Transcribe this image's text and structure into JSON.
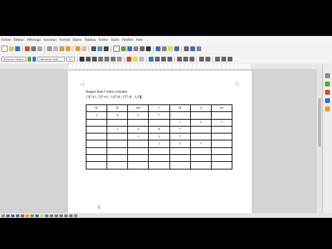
{
  "menu": {
    "items": [
      "Fichier",
      "Édition",
      "Affichage",
      "Insertion",
      "Format",
      "Styles",
      "Tableau",
      "Forme",
      "Outils",
      "Fenêtre",
      "Aide"
    ]
  },
  "toolbar": {
    "style_name": "Style par défaut",
    "font_name": "Liberation Serif",
    "font_size": "12"
  },
  "document": {
    "line1": "Ranges dans l’ordre croissant:",
    "line2": "1,07 kl ; 137 rcl ; 1,07 hl ; 157 dl ; 1,37",
    "table": {
      "header": [
        "kl",
        "hl",
        "dal",
        "l",
        "dl",
        "cl",
        "ml"
      ],
      "rows": [
        [
          "1",
          "0",
          "5",
          "7",
          "",
          "",
          ""
        ],
        [
          "",
          "",
          "",
          "",
          "1",
          "3",
          "7"
        ],
        [
          "",
          "1",
          "5",
          "0",
          "7",
          "",
          ""
        ],
        [
          "",
          "",
          "1",
          "5",
          "7",
          "",
          ""
        ],
        [
          "",
          "",
          "",
          "1",
          "3",
          "7",
          ""
        ],
        [
          "",
          "",
          "",
          "",
          "",
          "",
          ""
        ],
        [
          "",
          "",
          "",
          "",
          "",
          "",
          ""
        ],
        [
          "",
          "",
          "",
          "",
          "",
          "",
          ""
        ]
      ]
    }
  },
  "colors": {
    "letterbox": "#000000",
    "workspace": "#d4d4d4",
    "page": "#ffffff",
    "accent_blue": "#3a6fc4",
    "accent_green": "#5aa832",
    "accent_red": "#d8443a",
    "accent_orange": "#e89a2b"
  }
}
